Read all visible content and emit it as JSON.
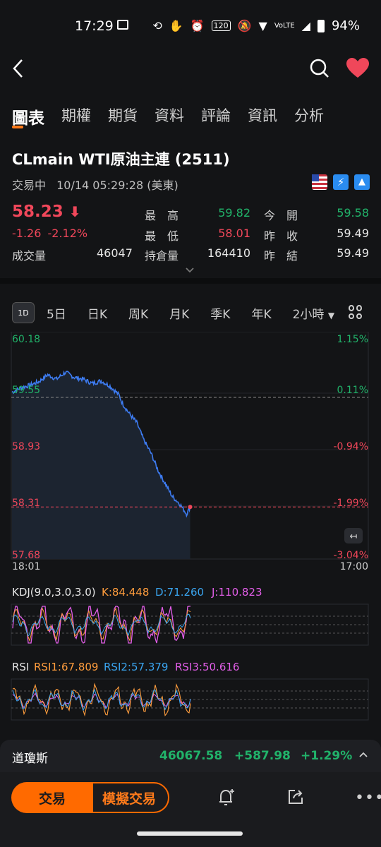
{
  "status_bar": {
    "time": "17:29",
    "battery": "94%"
  },
  "tabs": [
    "圖表",
    "期權",
    "期貨",
    "資料",
    "評論",
    "資訊",
    "分析"
  ],
  "instrument": {
    "title": "CLmain  WTI原油主連 (2511)",
    "status": "交易中",
    "datetime": "10/14 05:29:28 (美東)"
  },
  "quote": {
    "price": "58.23",
    "change": "-1.26",
    "change_pct": "-2.12%",
    "volume_label": "成交量",
    "volume": "46047",
    "high_label": "最　高",
    "high": "59.82",
    "low_label": "最　低",
    "low": "58.01",
    "oi_label": "持倉量",
    "oi": "164410",
    "open_label": "今　開",
    "open": "59.58",
    "prev_close_label": "昨　收",
    "prev_close": "59.49",
    "prev_settle_label": "昨　結",
    "prev_settle": "59.49"
  },
  "periods": {
    "badge": "1D",
    "items": [
      "5日",
      "日K",
      "周K",
      "月K",
      "季K",
      "年K",
      "2小時"
    ]
  },
  "chart_data": {
    "type": "line",
    "y_labels": [
      "60.18",
      "59.55",
      "58.93",
      "58.31",
      "57.68"
    ],
    "pct_labels": [
      "1.15%",
      "0.11%",
      "-0.94%",
      "-1.99%",
      "-3.04%"
    ],
    "x_start": "18:01",
    "x_end": "17:00",
    "prev_close": 59.49,
    "last": 58.23,
    "ylim": [
      57.68,
      60.18
    ],
    "x": [
      0,
      5,
      10,
      15,
      20,
      25,
      30,
      35,
      40,
      45,
      50,
      55,
      60,
      62,
      66,
      70,
      74,
      78,
      82,
      86,
      90,
      94,
      98,
      100
    ],
    "y": [
      59.55,
      59.6,
      59.63,
      59.67,
      59.75,
      59.7,
      59.78,
      59.72,
      59.7,
      59.65,
      59.68,
      59.62,
      59.52,
      59.42,
      59.3,
      59.2,
      59.0,
      58.85,
      58.65,
      58.5,
      58.35,
      58.27,
      58.15,
      58.23
    ]
  },
  "kdj": {
    "label": "KDJ(9.0,3.0,3.0)",
    "k": "K:84.448",
    "d": "D:71.260",
    "j": "J:110.823"
  },
  "rsi": {
    "label": "RSI",
    "rsi1": "RSI1:67.809",
    "rsi2": "RSI2:57.379",
    "rsi3": "RSI3:50.616"
  },
  "ticker": {
    "name": "道瓊斯",
    "value": "46067.58",
    "change": "+587.98",
    "pct": "+1.29%"
  },
  "actions": {
    "trade": "交易",
    "sim_trade": "模擬交易"
  },
  "colors": {
    "accent": "#ff6a00",
    "up": "#21b36a",
    "down": "#f0475a",
    "line": "#3d7bf0"
  }
}
